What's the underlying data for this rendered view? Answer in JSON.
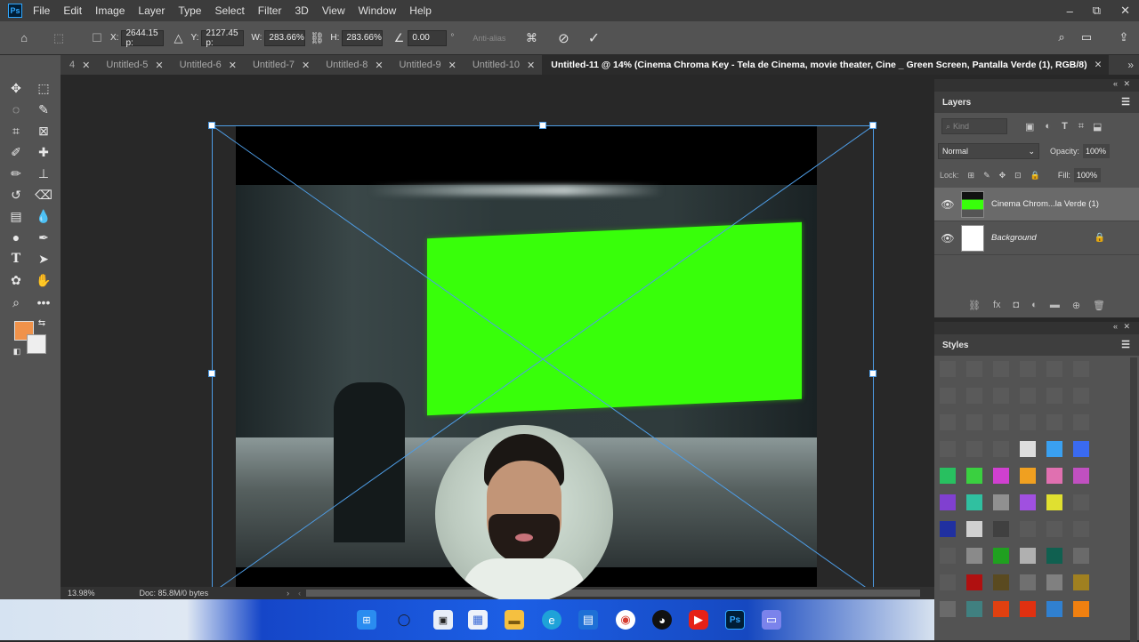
{
  "app": {
    "logo": "Ps",
    "menu": [
      "File",
      "Edit",
      "Image",
      "Layer",
      "Type",
      "Select",
      "Filter",
      "3D",
      "View",
      "Window",
      "Help"
    ],
    "window_controls": [
      "–",
      "⧉",
      "✕"
    ]
  },
  "options": {
    "x_label": "X:",
    "x_value": "2644.15 p:",
    "y_label": "Y:",
    "y_value": "2127.45 p:",
    "w_label": "W:",
    "w_value": "283.66%",
    "h_label": "H:",
    "h_value": "283.66%",
    "angle_value": "0.00",
    "angle_unit": "°",
    "antialias": "Anti-alias"
  },
  "tabs": [
    {
      "label": "4"
    },
    {
      "label": "Untitled-5"
    },
    {
      "label": "Untitled-6"
    },
    {
      "label": "Untitled-7"
    },
    {
      "label": "Untitled-8"
    },
    {
      "label": "Untitled-9"
    },
    {
      "label": "Untitled-10"
    },
    {
      "label": "Untitled-11 @ 14% (Cinema Chroma Key - Tela de Cinema, movie theater, Cine _ Green Screen, Pantalla Verde (1), RGB/8)"
    }
  ],
  "tab_close": "✕",
  "colors": {
    "foreground": "#f0924a",
    "background": "#eeeeee",
    "green_screen": "#38ff0a",
    "accent": "#4e9de6"
  },
  "status": {
    "zoom": "13.98%",
    "doc": "Doc: 85.8M/0 bytes"
  },
  "layers_panel": {
    "title": "Layers",
    "kind_placeholder": "Kind",
    "blend_mode": "Normal",
    "opacity_label": "Opacity:",
    "opacity_value": "100%",
    "lock_label": "Lock:",
    "fill_label": "Fill:",
    "fill_value": "100%",
    "layers": [
      {
        "name": "Cinema Chrom...la Verde (1)",
        "selected": true
      },
      {
        "name": "Background",
        "locked": true
      }
    ]
  },
  "styles_panel": {
    "title": "Styles"
  }
}
